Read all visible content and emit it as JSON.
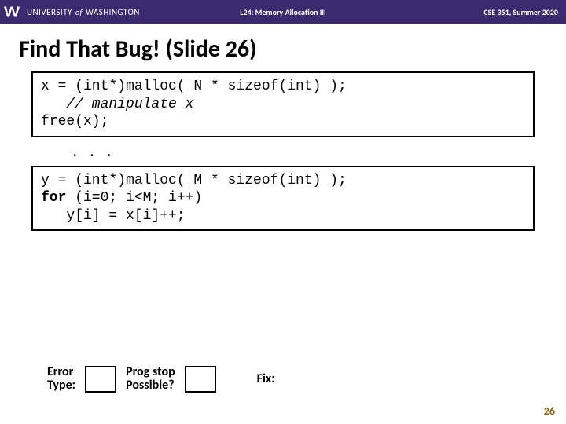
{
  "header": {
    "university_part1": "UNIVERSITY",
    "university_of": "of",
    "university_part2": "WASHINGTON",
    "lecture": "L24: Memory Allocation III",
    "course": "CSE 351, Summer 2020"
  },
  "title": "Find That Bug!  (Slide 26)",
  "code": {
    "block1_line1": "x = (int*)malloc( N * sizeof(int) );",
    "block1_line2_indent": "   ",
    "block1_line2_comment": "// manipulate x",
    "block1_line3": "free(x);",
    "ellipsis": ". . .",
    "block2_line1": "y = (int*)malloc( M * sizeof(int) );",
    "block2_line2_kw": "for",
    "block2_line2_rest": " (i=0; i<M; i++)",
    "block2_line3": "   y[i] = x[i]++;"
  },
  "answers": {
    "error_type_label": "Error\nType:",
    "prog_stop_label": "Prog stop\nPossible?",
    "fix_label": "Fix:"
  },
  "page_number": "26"
}
